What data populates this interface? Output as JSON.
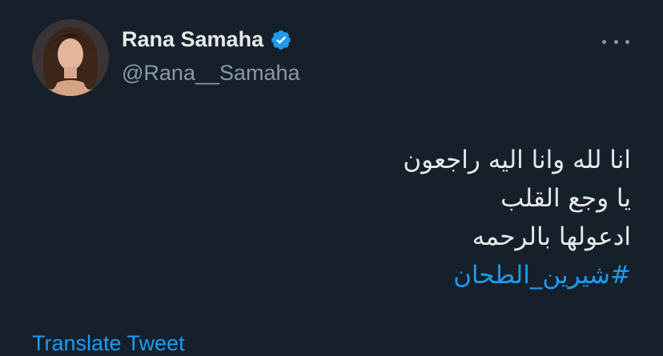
{
  "author": {
    "display_name": "Rana Samaha",
    "handle": "@Rana__Samaha",
    "verified": true,
    "avatar_icon": "profile-photo"
  },
  "tweet": {
    "lines": [
      "انا لله وانا اليه راجعون",
      "يا وجع القلب",
      "ادعولها بالرحمه"
    ],
    "hashtag": "#شيرين_الطحان"
  },
  "footer": {
    "translate_label": "Translate Tweet"
  },
  "colors": {
    "background": "#15202b",
    "primary_text": "#e7e9ea",
    "secondary_text": "#8b98a5",
    "accent": "#1d9bf0"
  }
}
